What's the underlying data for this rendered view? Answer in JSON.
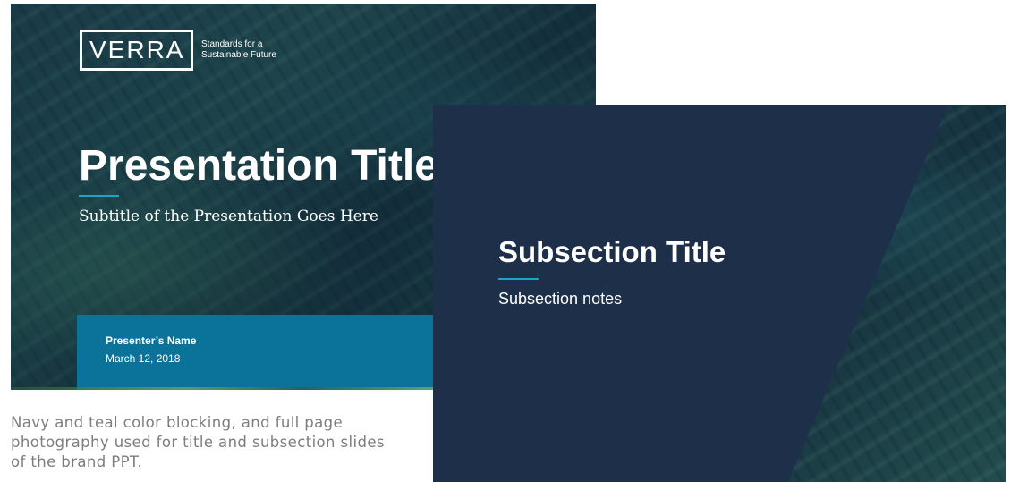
{
  "title_slide": {
    "logo_text": "VERRA",
    "logo_tagline": "Standards for a Sustainable Future",
    "title": "Presentation Title",
    "subtitle": "Subtitle of the Presentation Goes Here",
    "presenter_name": "Presenter’s Name",
    "date": "March 12, 2018"
  },
  "subsection_slide": {
    "title": "Subsection Title",
    "notes": "Subsection notes"
  },
  "caption": "Navy and teal color blocking, and full page photography used for title and subsection slides of the brand PPT.",
  "colors": {
    "navy": "#1e2f4a",
    "teal": "#0b7299",
    "accent_line": "#1aa6c9",
    "caption_text": "#7d7d7d"
  }
}
